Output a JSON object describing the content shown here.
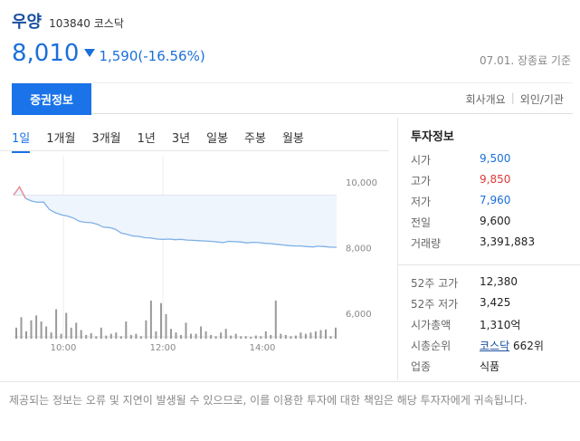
{
  "stock": {
    "name": "우양",
    "code": "103840",
    "market": "코스닥",
    "price": "8,010",
    "change": "1,590(-16.56%)",
    "date_label": "07.01. 장종료 기준"
  },
  "tabs": {
    "active": "증권정보",
    "right": [
      "회사개요",
      "외인/기관"
    ]
  },
  "periods": [
    "1일",
    "1개월",
    "3개월",
    "1년",
    "3년",
    "일봉",
    "주봉",
    "월봉"
  ],
  "chart_data": {
    "type": "line",
    "title": "",
    "x_ticks": [
      "10:00",
      "12:00",
      "14:00"
    ],
    "y_ticks": [
      10000,
      8000,
      6000
    ],
    "y_tick_labels": [
      "10,000",
      "8,000",
      "6,000"
    ],
    "ylim": [
      5000,
      10800
    ],
    "reference_price": 9600,
    "price_series": [
      9600,
      9850,
      9500,
      9420,
      9380,
      9390,
      9160,
      9060,
      9000,
      8960,
      8900,
      8800,
      8770,
      8760,
      8710,
      8620,
      8610,
      8560,
      8440,
      8400,
      8350,
      8340,
      8300,
      8290,
      8260,
      8250,
      8260,
      8240,
      8250,
      8230,
      8220,
      8210,
      8200,
      8190,
      8170,
      8150,
      8190,
      8180,
      8170,
      8140,
      8160,
      8150,
      8130,
      8120,
      8100,
      8080,
      8060,
      8050,
      8050,
      8030,
      8020,
      8040,
      8030,
      8010,
      8010
    ],
    "volume_series": [
      18,
      35,
      12,
      30,
      38,
      28,
      20,
      10,
      48,
      8,
      42,
      18,
      26,
      14,
      6,
      9,
      4,
      18,
      5,
      8,
      10,
      4,
      28,
      6,
      8,
      4,
      30,
      62,
      12,
      58,
      40,
      16,
      10,
      6,
      26,
      8,
      8,
      20,
      12,
      6,
      4,
      10,
      16,
      5,
      8,
      4,
      4,
      3,
      5,
      4,
      12,
      6,
      62,
      8,
      6,
      4,
      5,
      10,
      8,
      10,
      12,
      14,
      15,
      4,
      18
    ],
    "grid": true
  },
  "info": {
    "title": "투자정보",
    "rows": [
      {
        "label": "시가",
        "value": "9,500",
        "color": "blue"
      },
      {
        "label": "고가",
        "value": "9,850",
        "color": "red"
      },
      {
        "label": "저가",
        "value": "7,960",
        "color": "blue"
      },
      {
        "label": "전일",
        "value": "9,600",
        "color": "normal"
      },
      {
        "label": "거래량",
        "value": "3,391,883",
        "color": "normal"
      }
    ],
    "rows2": [
      {
        "label": "52주 고가",
        "value": "12,380"
      },
      {
        "label": "52주 저가",
        "value": "3,425"
      },
      {
        "label": "시가총액",
        "value": "1,310억"
      }
    ],
    "rank_label": "시총순위",
    "rank_market": "코스닥",
    "rank_value": "662위",
    "industry_label": "업종",
    "industry_value": "식품"
  },
  "disclaimer": "제공되는 정보는 오류 및 지연이 발생될 수 있으므로, 이를 이용한 투자에 대한 책임은 해당 투자자에게 귀속됩니다.",
  "colors": {
    "accent": "#1a73e8",
    "price_down": "#1a6fd8",
    "price_up": "#e03a3a",
    "area_fill": "#eef5fd",
    "line": "#7fb0e6",
    "volume": "#9a9a9a"
  }
}
